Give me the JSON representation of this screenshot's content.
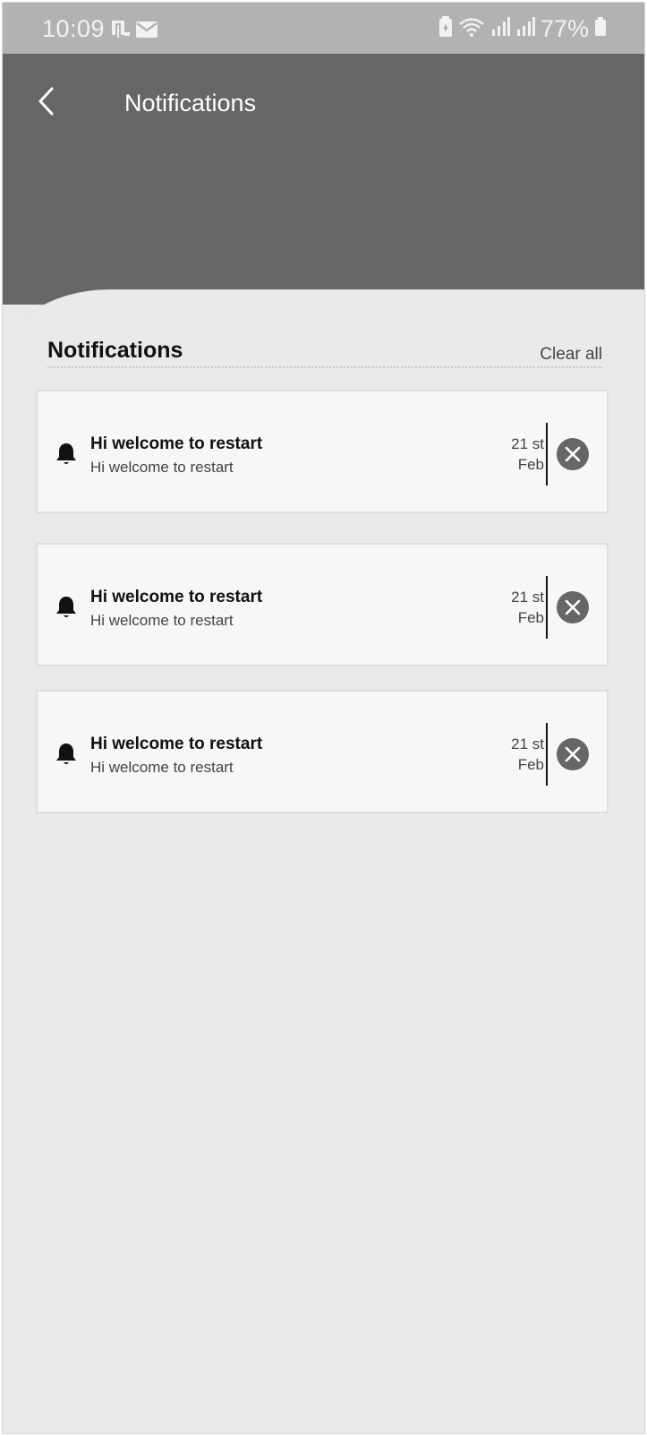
{
  "status_bar": {
    "time": "10:09",
    "battery": "77%",
    "icons_left": [
      "device-icon",
      "mail-icon"
    ],
    "icons_right": [
      "battery-saver-icon",
      "wifi-icon",
      "signal-icon",
      "signal-icon",
      "battery-icon"
    ]
  },
  "header": {
    "title": "Notifications",
    "back_icon": "chevron-left-icon",
    "color": "#666666"
  },
  "section": {
    "title": "Notifications",
    "clear_all": "Clear all"
  },
  "notifications": [
    {
      "title": "Hi welcome to restart",
      "body": "Hi welcome to restart",
      "date_line1": "21 st",
      "date_line2": "Feb"
    },
    {
      "title": "Hi welcome to restart",
      "body": "Hi welcome to restart",
      "date_line1": "21 st",
      "date_line2": "Feb"
    },
    {
      "title": "Hi welcome to restart",
      "body": "Hi welcome to restart",
      "date_line1": "21 st",
      "date_line2": "Feb"
    }
  ],
  "colors": {
    "status_bar": "#b2b2b2",
    "background": "#eaeaea",
    "card": "#f7f7f7",
    "close_button": "#666666"
  }
}
